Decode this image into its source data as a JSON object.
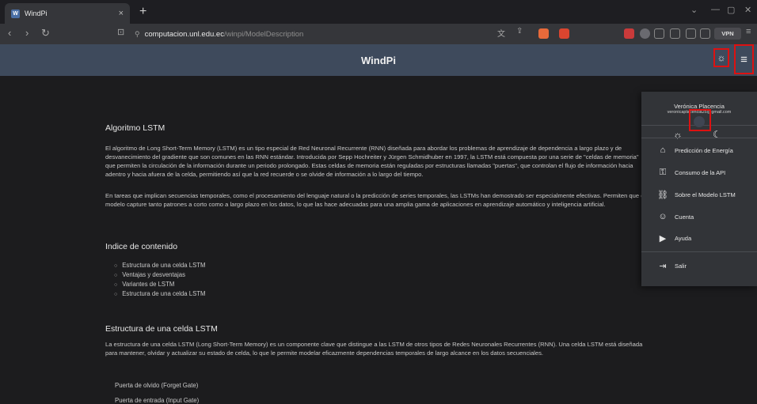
{
  "browser": {
    "tab_title": "WindPi",
    "tab_close": "×",
    "new_tab": "+",
    "url_host": "computacion.unl.edu.ec",
    "url_path": "/winpi/ModelDescription",
    "vpn_label": "VPN"
  },
  "app": {
    "title": "WindPi"
  },
  "content": {
    "section1": {
      "heading": "Algoritmo LSTM",
      "paragraph1": "El algoritmo de Long Short-Term Memory (LSTM) es un tipo especial de Red Neuronal Recurrente (RNN) diseñada para abordar los problemas de aprendizaje de dependencia a largo plazo y de desvanecimiento del gradiente que son comunes en las RNN estándar. Introducida por Sepp Hochreiter y Jürgen Schmidhuber en 1997, la LSTM está compuesta por una serie de \"celdas de memoria\" que permiten la circulación de la información durante un periodo prolongado. Estas celdas de memoria están reguladas por estructuras llamadas \"puertas\", que controlan el flujo de información hacia adentro y hacia afuera de la celda, permitiendo así que la red recuerde o se olvide de información a lo largo del tiempo.",
      "paragraph2": "En tareas que implican secuencias temporales, como el procesamiento del lenguaje natural o la predicción de series temporales, las LSTMs han demostrado ser especialmente efectivas. Permiten que el modelo capture tanto patrones a corto como a largo plazo en los datos, lo que las hace adecuadas para una amplia gama de aplicaciones en aprendizaje automático y inteligencia artificial."
    },
    "toc": {
      "heading": "Indice de contenido",
      "items": [
        "Estructura de una celda LSTM",
        "Ventajas y desventajas",
        "Variantes de LSTM",
        "Estructura de una celda LSTM"
      ]
    },
    "section2": {
      "heading": "Estructura de una celda LSTM",
      "paragraph": "La estructura de una celda LSTM (Long Short-Term Memory) es un componente clave que distingue a las LSTM de otros tipos de Redes Neuronales Recurrentes (RNN). Una celda LSTM está diseñada para mantener, olvidar y actualizar su estado de celda, lo que le permite modelar eficazmente dependencias temporales de largo alcance en los datos secuenciales.",
      "gate1": "Puerta de olvido (Forget Gate)",
      "gate2": "Puerta de entrada (Input Gate)"
    }
  },
  "user_menu": {
    "name": "Verónica Placencia",
    "email": "veronicaplacencia25@gmail.com",
    "items": [
      {
        "label": "Predicción de Energía",
        "icon": "home-icon"
      },
      {
        "label": "Consumo de la API",
        "icon": "key-icon"
      },
      {
        "label": "Sobre el Modelo LSTM",
        "icon": "model-icon"
      },
      {
        "label": "Cuenta",
        "icon": "account-icon"
      },
      {
        "label": "Ayuda",
        "icon": "help-icon"
      }
    ],
    "logout": "Salir"
  },
  "colors": {
    "appbar": "#3e4a5c",
    "highlight": "#dd1111",
    "background": "#1c1c1e"
  }
}
